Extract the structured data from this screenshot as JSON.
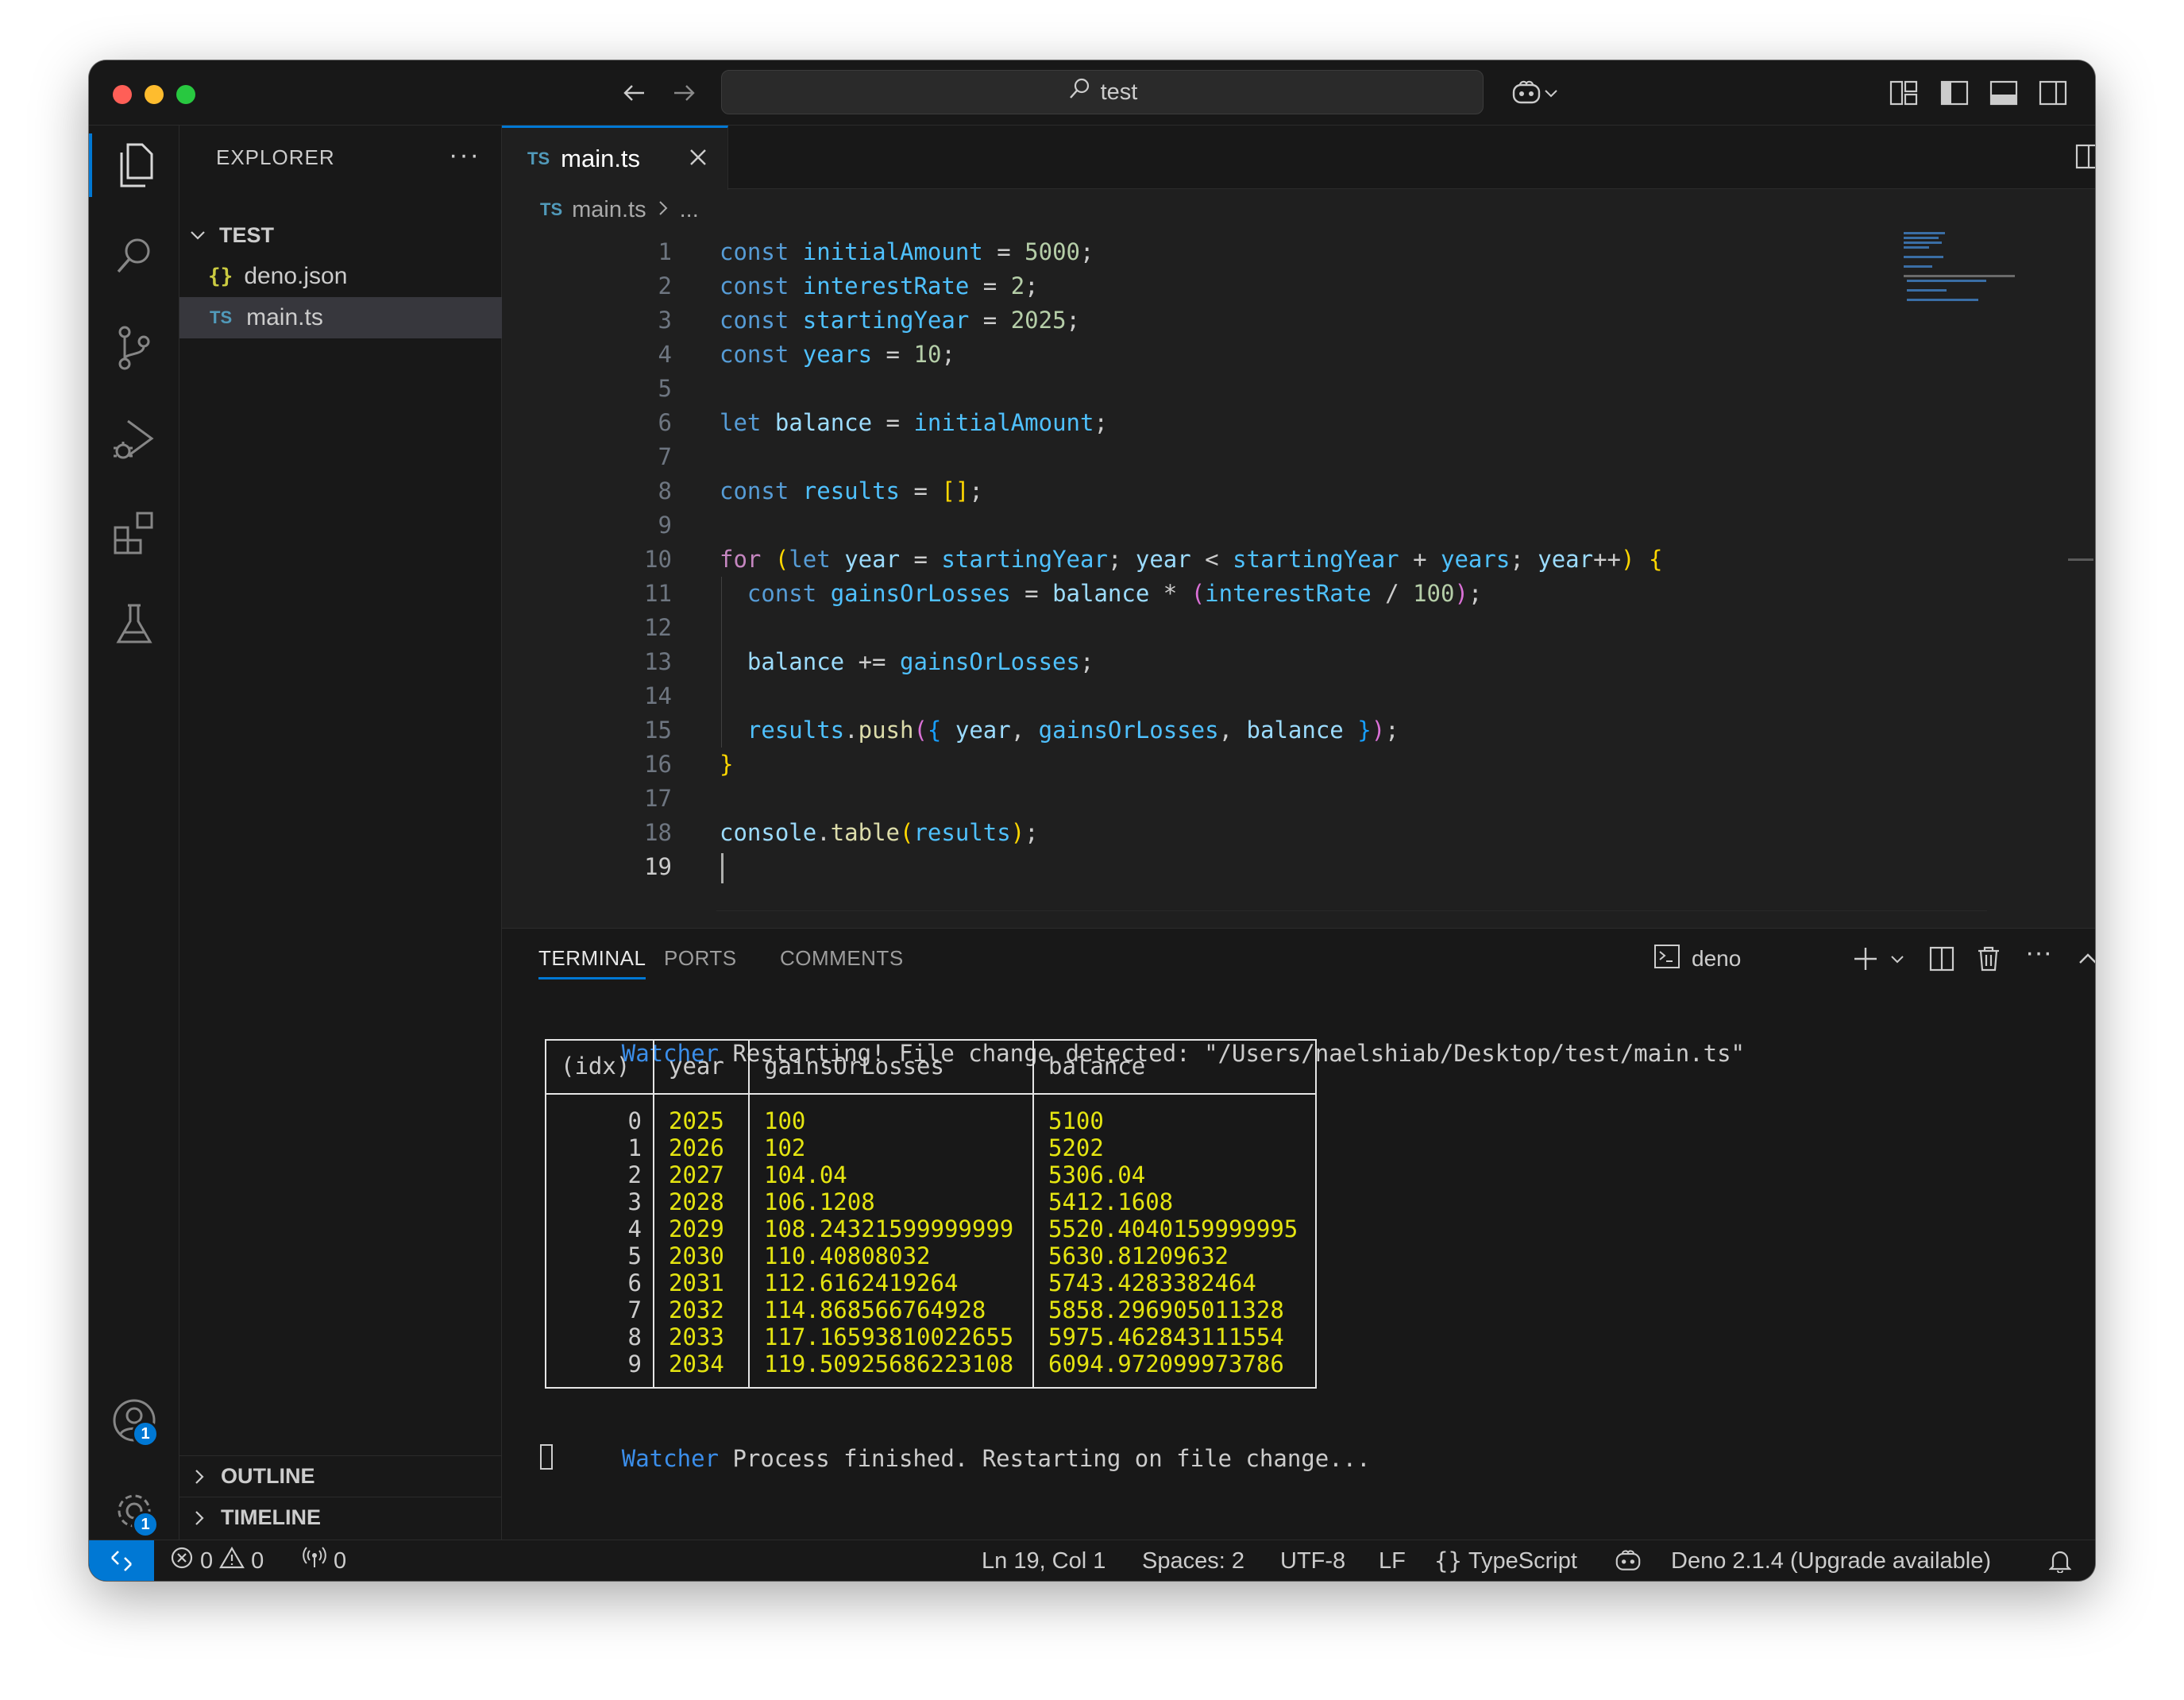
{
  "titlebar": {
    "search_text": "test"
  },
  "activity": {
    "accounts_badge": "1",
    "settings_badge": "1"
  },
  "explorer": {
    "title": "EXPLORER",
    "folder": "TEST",
    "files": [
      {
        "name": "deno.json",
        "icon": "{}"
      },
      {
        "name": "main.ts",
        "icon": "TS"
      }
    ],
    "outline": "OUTLINE",
    "timeline": "TIMELINE"
  },
  "editor": {
    "tab": {
      "icon": "TS",
      "label": "main.ts"
    },
    "breadcrumb": {
      "icon": "TS",
      "file": "main.ts",
      "rest": "..."
    },
    "line_numbers": [
      "1",
      "2",
      "3",
      "4",
      "5",
      "6",
      "7",
      "8",
      "9",
      "10",
      "11",
      "12",
      "13",
      "14",
      "15",
      "16",
      "17",
      "18",
      "19"
    ],
    "code": [
      "const initialAmount = 5000;",
      "const interestRate = 2;",
      "const startingYear = 2025;",
      "const years = 10;",
      "",
      "let balance = initialAmount;",
      "",
      "const results = [];",
      "",
      "for (let year = startingYear; year < startingYear + years; year++) {",
      "  const gainsOrLosses = balance * (interestRate / 100);",
      "",
      "  balance += gainsOrLosses;",
      "",
      "  results.push({ year, gainsOrLosses, balance });",
      "}",
      "",
      "console.table(results);",
      ""
    ]
  },
  "panel": {
    "tabs": [
      "TERMINAL",
      "PORTS",
      "COMMENTS"
    ],
    "terminal_name": "deno",
    "line1_prefix": "Watcher",
    "line1_text": " Restarting! File change detected: \"/Users/naelshiab/Desktop/test/main.ts\"",
    "table_headers": [
      "(idx)",
      "year",
      "gainsOrLosses",
      "balance"
    ],
    "table_rows": [
      [
        "0",
        "2025",
        "100",
        "5100"
      ],
      [
        "1",
        "2026",
        "102",
        "5202"
      ],
      [
        "2",
        "2027",
        "104.04",
        "5306.04"
      ],
      [
        "3",
        "2028",
        "106.1208",
        "5412.1608"
      ],
      [
        "4",
        "2029",
        "108.24321599999999",
        "5520.4040159999995"
      ],
      [
        "5",
        "2030",
        "110.40808032",
        "5630.81209632"
      ],
      [
        "6",
        "2031",
        "112.6162419264",
        "5743.4283382464"
      ],
      [
        "7",
        "2032",
        "114.868566764928",
        "5858.296905011328"
      ],
      [
        "8",
        "2033",
        "117.16593810022655",
        "5975.462843111554"
      ],
      [
        "9",
        "2034",
        "119.50925686223108",
        "6094.972099973786"
      ]
    ],
    "line2_prefix": "Watcher",
    "line2_text": " Process finished. Restarting on file change..."
  },
  "statusbar": {
    "errors": "0",
    "warnings": "0",
    "ports": "0",
    "position": "Ln 19, Col 1",
    "spaces": "Spaces: 2",
    "encoding": "UTF-8",
    "eol": "LF",
    "language": "TypeScript",
    "deno": "Deno 2.1.4 (Upgrade available)"
  },
  "colors": {
    "accent": "#0078d4",
    "terminal_yellow": "#e5e510",
    "watcher_blue": "#3b8eea",
    "keyword": "#569cd6"
  },
  "icons": [
    "explorer-icon",
    "search-icon",
    "source-control-icon",
    "run-debug-icon",
    "extensions-icon",
    "testing-icon",
    "accounts-icon",
    "settings-gear-icon",
    "copilot-icon",
    "bell-icon"
  ]
}
